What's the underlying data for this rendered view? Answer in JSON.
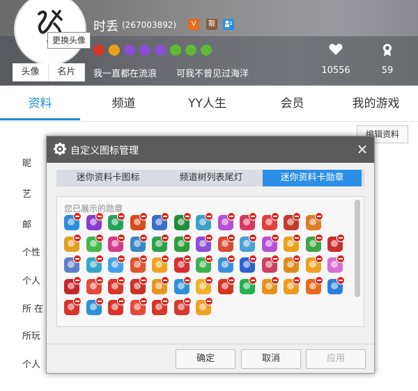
{
  "profile": {
    "nickname": "时丢",
    "uid": "(267003892)",
    "vip_badge": "V",
    "tag_badge": "靓",
    "avatar_tooltip": "更换头像",
    "avatar_tabs": [
      "头像",
      "名片"
    ],
    "signature": [
      "我一直都在流浪",
      "可我不曾见过海洋"
    ],
    "stats": [
      {
        "icon": "heart-icon",
        "value": "10556"
      },
      {
        "icon": "badge-person-icon",
        "value": "59"
      }
    ]
  },
  "nav": {
    "tabs": [
      "资料",
      "频道",
      "YY人生",
      "会员",
      "我的游戏"
    ],
    "active": "资料",
    "edit_button": "编辑资料"
  },
  "background_labels": [
    "昵",
    "艺",
    "邮",
    "个性",
    "个人",
    "所 在",
    "所玩",
    "个人"
  ],
  "dialog": {
    "title": "自定义图标管理",
    "close_label": "×",
    "tabs": [
      "迷你资料卡图标",
      "频道树列表尾灯",
      "迷你资料卡勋章"
    ],
    "active_tab": "迷你资料卡勋章",
    "panel_caption": "您已展示的勋章",
    "badge_rows": [
      [
        "#2d8be0",
        "#8b3cd0",
        "#27a35a",
        "#d94a1c",
        "#3a6fc9",
        "#1f8d3a",
        "#3aa0c8",
        "#b64fd6",
        "#d8365f",
        "#e04040",
        "#c43a2e",
        "#e07b2a"
      ],
      [
        "#e0a020",
        "#41b84a",
        "#d63a8a",
        "#3d86c6",
        "#2da04b",
        "#2e9d3c",
        "#8a4ed8",
        "#d94b36",
        "#4aa0d8",
        "#b650d8",
        "#e8a21a",
        "#3fa445",
        "#c8302d"
      ],
      [
        "#5d7fc7",
        "#34a5c8",
        "#43a1e8",
        "#e0562c",
        "#f0a320",
        "#d42e2e",
        "#3bb04e",
        "#3b8fd8",
        "#2c62d0",
        "#d1405e",
        "#e08a1c",
        "#f0a020",
        "#d86fd0"
      ],
      [
        "#c6262e",
        "#e24a3a",
        "#d8362e",
        "#c83228",
        "#e49620",
        "#2e8fd8",
        "#f0b030",
        "#d83422",
        "#23b04e",
        "#e8901c",
        "#f09a20",
        "#e86a1c",
        "#2c7fdc"
      ],
      [
        "#d8342a",
        "#2d8fd8",
        "#d8342a",
        "#e24a3a",
        "#d8342a",
        "#d83a2c",
        "#f0a020"
      ]
    ],
    "buttons": {
      "ok": "确定",
      "cancel": "取消",
      "apply": "应用"
    }
  }
}
